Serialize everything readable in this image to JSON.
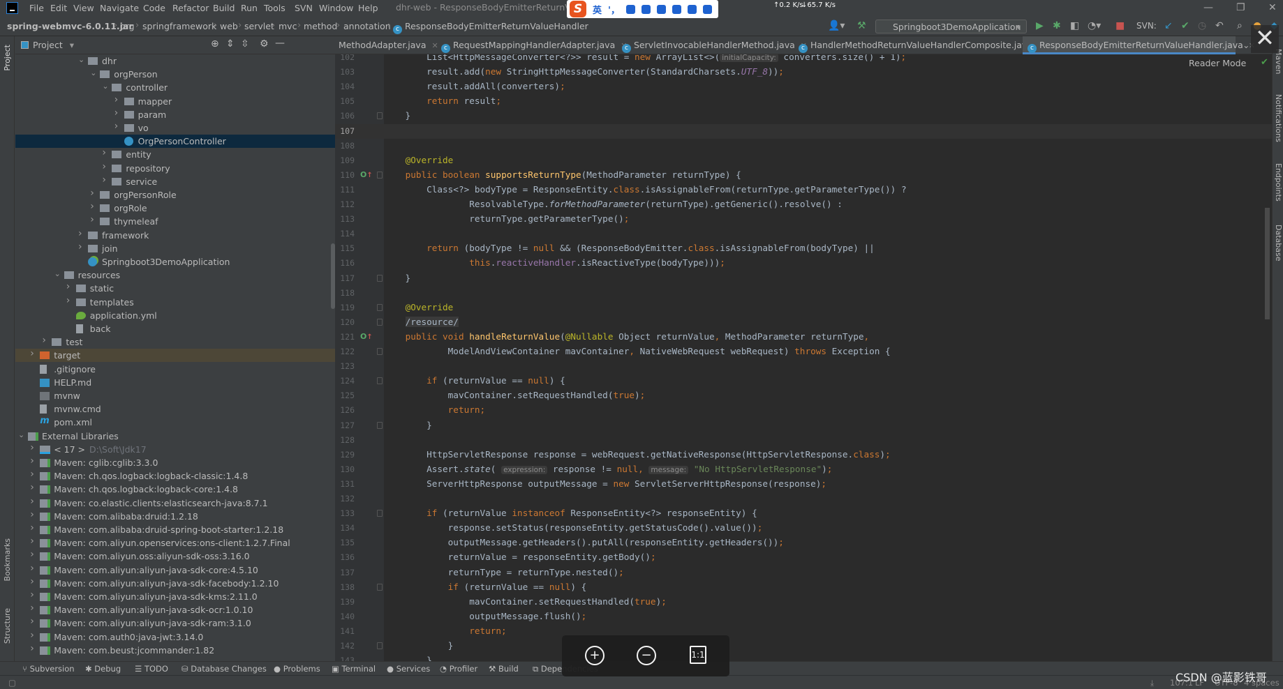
{
  "window": {
    "title": "dhr-web - ResponseBodyEmitterReturnValueHandler",
    "menu": [
      "File",
      "Edit",
      "View",
      "Navigate",
      "Code",
      "Refactor",
      "Build",
      "Run",
      "Tools",
      "SVN",
      "Window",
      "Help"
    ],
    "ime": {
      "lang": "英",
      "punct": "'，"
    },
    "net_up": "↑0.2 K/s",
    "net_down": "↓65.7 K/s"
  },
  "breadcrumb": [
    "spring-webmvc-6.0.11.jar",
    "org",
    "springframework",
    "web",
    "servlet",
    "mvc",
    "method",
    "annotation",
    "ResponseBodyEmitterReturnValueHandler"
  ],
  "toolbar": {
    "run_config": "Springboot3DemoApplication",
    "svn_label": "SVN:"
  },
  "project_panel": {
    "title": "Project",
    "items": [
      {
        "label": "dhr",
        "level": 5,
        "expand": "open",
        "icon": "folder"
      },
      {
        "label": "orgPerson",
        "level": 6,
        "expand": "open",
        "icon": "folder"
      },
      {
        "label": "controller",
        "level": 7,
        "expand": "open",
        "icon": "folder"
      },
      {
        "label": "mapper",
        "level": 8,
        "expand": "closed",
        "icon": "folder"
      },
      {
        "label": "param",
        "level": 8,
        "expand": "closed",
        "icon": "folder"
      },
      {
        "label": "vo",
        "level": 8,
        "expand": "closed",
        "icon": "folder"
      },
      {
        "label": "OrgPersonController",
        "level": 8,
        "icon": "cls",
        "selected": true
      },
      {
        "label": "entity",
        "level": 7,
        "expand": "closed",
        "icon": "folder"
      },
      {
        "label": "repository",
        "level": 7,
        "expand": "closed",
        "icon": "folder"
      },
      {
        "label": "service",
        "level": 7,
        "expand": "closed",
        "icon": "folder"
      },
      {
        "label": "orgPersonRole",
        "level": 6,
        "expand": "closed",
        "icon": "folder"
      },
      {
        "label": "orgRole",
        "level": 6,
        "expand": "closed",
        "icon": "folder"
      },
      {
        "label": "thymeleaf",
        "level": 6,
        "expand": "closed",
        "icon": "folder"
      },
      {
        "label": "framework",
        "level": 5,
        "expand": "closed",
        "icon": "folder"
      },
      {
        "label": "join",
        "level": 5,
        "expand": "closed",
        "icon": "folder"
      },
      {
        "label": "Springboot3DemoApplication",
        "level": 5,
        "icon": "spring"
      },
      {
        "label": "resources",
        "level": 3,
        "expand": "open",
        "icon": "folder"
      },
      {
        "label": "static",
        "level": 4,
        "expand": "closed",
        "icon": "folder"
      },
      {
        "label": "templates",
        "level": 4,
        "expand": "closed",
        "icon": "folder"
      },
      {
        "label": "application.yml",
        "level": 4,
        "icon": "yml"
      },
      {
        "label": "back",
        "level": 4,
        "icon": "file"
      },
      {
        "label": "test",
        "level": 2,
        "expand": "closed",
        "icon": "folder"
      },
      {
        "label": "target",
        "level": 1,
        "expand": "closed",
        "icon": "folder-orange",
        "highlight": true
      },
      {
        "label": ".gitignore",
        "level": 1,
        "icon": "file"
      },
      {
        "label": "HELP.md",
        "level": 1,
        "icon": "md"
      },
      {
        "label": "mvnw",
        "level": 1,
        "icon": "exec"
      },
      {
        "label": "mvnw.cmd",
        "level": 1,
        "icon": "file"
      },
      {
        "label": "pom.xml",
        "level": 1,
        "icon": "maven"
      },
      {
        "label": "External Libraries",
        "level": 0,
        "expand": "open",
        "icon": "lib"
      },
      {
        "label": "< 17 >",
        "level": 1,
        "expand": "closed",
        "icon": "jdk",
        "suffix": "D:\\Soft\\Jdk17"
      },
      {
        "label": "Maven: cglib:cglib:3.3.0",
        "level": 1,
        "expand": "closed",
        "icon": "lib"
      },
      {
        "label": "Maven: ch.qos.logback:logback-classic:1.4.8",
        "level": 1,
        "expand": "closed",
        "icon": "lib"
      },
      {
        "label": "Maven: ch.qos.logback:logback-core:1.4.8",
        "level": 1,
        "expand": "closed",
        "icon": "lib"
      },
      {
        "label": "Maven: co.elastic.clients:elasticsearch-java:8.7.1",
        "level": 1,
        "expand": "closed",
        "icon": "lib"
      },
      {
        "label": "Maven: com.alibaba:druid:1.2.18",
        "level": 1,
        "expand": "closed",
        "icon": "lib"
      },
      {
        "label": "Maven: com.alibaba:druid-spring-boot-starter:1.2.18",
        "level": 1,
        "expand": "closed",
        "icon": "lib"
      },
      {
        "label": "Maven: com.aliyun.openservices:ons-client:1.2.7.Final",
        "level": 1,
        "expand": "closed",
        "icon": "lib"
      },
      {
        "label": "Maven: com.aliyun.oss:aliyun-sdk-oss:3.16.0",
        "level": 1,
        "expand": "closed",
        "icon": "lib"
      },
      {
        "label": "Maven: com.aliyun:aliyun-java-sdk-core:4.5.10",
        "level": 1,
        "expand": "closed",
        "icon": "lib"
      },
      {
        "label": "Maven: com.aliyun:aliyun-java-sdk-facebody:1.2.10",
        "level": 1,
        "expand": "closed",
        "icon": "lib"
      },
      {
        "label": "Maven: com.aliyun:aliyun-java-sdk-kms:2.11.0",
        "level": 1,
        "expand": "closed",
        "icon": "lib"
      },
      {
        "label": "Maven: com.aliyun:aliyun-java-sdk-ocr:1.0.10",
        "level": 1,
        "expand": "closed",
        "icon": "lib"
      },
      {
        "label": "Maven: com.aliyun:aliyun-java-sdk-ram:3.1.0",
        "level": 1,
        "expand": "closed",
        "icon": "lib"
      },
      {
        "label": "Maven: com.auth0:java-jwt:3.14.0",
        "level": 1,
        "expand": "closed",
        "icon": "lib"
      },
      {
        "label": "Maven: com.beust:jcommander:1.82",
        "level": 1,
        "expand": "closed",
        "icon": "lib"
      }
    ]
  },
  "left_stripe": {
    "project": "Project",
    "bookmarks": "Bookmarks",
    "structure": "Structure"
  },
  "right_stripe": {
    "maven": "Maven",
    "notifications": "Notifications",
    "endpoints": "Endpoints",
    "database": "Database"
  },
  "editor": {
    "tabs": [
      {
        "label": "MethodAdapter.java",
        "active": false
      },
      {
        "label": "RequestMappingHandlerAdapter.java",
        "active": false
      },
      {
        "label": "ServletInvocableHandlerMethod.java",
        "active": false
      },
      {
        "label": "HandlerMethodReturnValueHandlerComposite.java",
        "active": false
      },
      {
        "label": "ResponseBodyEmitterReturnValueHandler.java",
        "active": true
      }
    ],
    "reader_mode": "Reader Mode",
    "current_line": 107,
    "lines": [
      {
        "n": 102,
        "t": [
          [
            "p",
            "        List<HttpMessageConverter<?>> result = "
          ],
          [
            "k",
            "new"
          ],
          [
            "p",
            " ArrayList<>("
          ],
          [
            "h",
            "initialCapacity:"
          ],
          [
            "p",
            " converters.size() + 1)"
          ],
          [
            "k",
            ";"
          ]
        ]
      },
      {
        "n": 103,
        "t": [
          [
            "p",
            "        result.add("
          ],
          [
            "k",
            "new"
          ],
          [
            "p",
            " StringHttpMessageConverter(StandardCharsets."
          ],
          [
            "sf",
            "UTF_8"
          ],
          [
            "p",
            "))"
          ],
          [
            "k",
            ";"
          ]
        ]
      },
      {
        "n": 104,
        "t": [
          [
            "p",
            "        result.addAll(converters)"
          ],
          [
            "k",
            ";"
          ]
        ]
      },
      {
        "n": 105,
        "t": [
          [
            "p",
            "        "
          ],
          [
            "k",
            "return"
          ],
          [
            "p",
            " result"
          ],
          [
            "k",
            ";"
          ]
        ]
      },
      {
        "n": 106,
        "t": [
          [
            "p",
            "    }"
          ]
        ],
        "fold": true
      },
      {
        "n": 107,
        "t": []
      },
      {
        "n": 108,
        "t": []
      },
      {
        "n": 109,
        "t": [
          [
            "p",
            "    "
          ],
          [
            "a",
            "@Override"
          ]
        ]
      },
      {
        "n": 110,
        "t": [
          [
            "p",
            "    "
          ],
          [
            "k",
            "public boolean"
          ],
          [
            "p",
            " "
          ],
          [
            "f",
            "supportsReturnType"
          ],
          [
            "p",
            "(MethodParameter returnType) {"
          ]
        ],
        "marker": true,
        "fold": true
      },
      {
        "n": 111,
        "t": [
          [
            "p",
            "        Class<?> bodyType = ResponseEntity."
          ],
          [
            "k",
            "class"
          ],
          [
            "p",
            ".isAssignableFrom(returnType.getParameterType()) ?"
          ]
        ]
      },
      {
        "n": 112,
        "t": [
          [
            "p",
            "                ResolvableType."
          ],
          [
            "i",
            "forMethodParameter"
          ],
          [
            "p",
            "(returnType).getGeneric().resolve() :"
          ]
        ]
      },
      {
        "n": 113,
        "t": [
          [
            "p",
            "                returnType.getParameterType()"
          ],
          [
            "k",
            ";"
          ]
        ]
      },
      {
        "n": 114,
        "t": []
      },
      {
        "n": 115,
        "t": [
          [
            "p",
            "        "
          ],
          [
            "k",
            "return"
          ],
          [
            "p",
            " (bodyType != "
          ],
          [
            "k",
            "null"
          ],
          [
            "p",
            " && (ResponseBodyEmitter."
          ],
          [
            "k",
            "class"
          ],
          [
            "p",
            ".isAssignableFrom(bodyType) ||"
          ]
        ]
      },
      {
        "n": 116,
        "t": [
          [
            "p",
            "                "
          ],
          [
            "k",
            "this"
          ],
          [
            "p",
            "."
          ],
          [
            "m",
            "reactiveHandler"
          ],
          [
            "p",
            ".isReactiveType(bodyType)))"
          ],
          [
            "k",
            ";"
          ]
        ]
      },
      {
        "n": 117,
        "t": [
          [
            "p",
            "    }"
          ]
        ],
        "fold": true
      },
      {
        "n": 118,
        "t": []
      },
      {
        "n": 119,
        "t": [
          [
            "p",
            "    "
          ],
          [
            "a",
            "@Override"
          ]
        ],
        "fold": true
      },
      {
        "n": 120,
        "t": [
          [
            "p",
            "    "
          ],
          [
            "g",
            "/resource/"
          ]
        ],
        "fold": true
      },
      {
        "n": 121,
        "t": [
          [
            "p",
            "    "
          ],
          [
            "k",
            "public void"
          ],
          [
            "p",
            " "
          ],
          [
            "f",
            "handleReturnValue"
          ],
          [
            "p",
            "("
          ],
          [
            "a",
            "@Nullable"
          ],
          [
            "p",
            " Object returnValue"
          ],
          [
            "k",
            ","
          ],
          [
            "p",
            " MethodParameter returnType"
          ],
          [
            "k",
            ","
          ]
        ],
        "marker": true
      },
      {
        "n": 122,
        "t": [
          [
            "p",
            "            ModelAndViewContainer mavContainer"
          ],
          [
            "k",
            ","
          ],
          [
            "p",
            " NativeWebRequest webRequest) "
          ],
          [
            "k",
            "throws"
          ],
          [
            "p",
            " Exception {"
          ]
        ],
        "fold": true
      },
      {
        "n": 123,
        "t": []
      },
      {
        "n": 124,
        "t": [
          [
            "p",
            "        "
          ],
          [
            "k",
            "if"
          ],
          [
            "p",
            " (returnValue == "
          ],
          [
            "k",
            "null"
          ],
          [
            "p",
            ") {"
          ]
        ],
        "fold": true
      },
      {
        "n": 125,
        "t": [
          [
            "p",
            "            mavContainer.setRequestHandled("
          ],
          [
            "k",
            "true"
          ],
          [
            "p",
            ")"
          ],
          [
            "k",
            ";"
          ]
        ]
      },
      {
        "n": 126,
        "t": [
          [
            "p",
            "            "
          ],
          [
            "k",
            "return;"
          ]
        ]
      },
      {
        "n": 127,
        "t": [
          [
            "p",
            "        }"
          ]
        ],
        "fold": true
      },
      {
        "n": 128,
        "t": []
      },
      {
        "n": 129,
        "t": [
          [
            "p",
            "        HttpServletResponse response = webRequest.getNativeResponse(HttpServletResponse."
          ],
          [
            "k",
            "class"
          ],
          [
            "p",
            ")"
          ],
          [
            "k",
            ";"
          ]
        ]
      },
      {
        "n": 130,
        "t": [
          [
            "p",
            "        Assert."
          ],
          [
            "i",
            "state"
          ],
          [
            "p",
            "( "
          ],
          [
            "h",
            "expression:"
          ],
          [
            "p",
            " response != "
          ],
          [
            "k",
            "null,"
          ],
          [
            "p",
            " "
          ],
          [
            "h",
            "message:"
          ],
          [
            "p",
            " "
          ],
          [
            "s",
            "\"No HttpServletResponse\""
          ],
          [
            "p",
            ")"
          ],
          [
            "k",
            ";"
          ]
        ]
      },
      {
        "n": 131,
        "t": [
          [
            "p",
            "        ServerHttpResponse outputMessage = "
          ],
          [
            "k",
            "new"
          ],
          [
            "p",
            " ServletServerHttpResponse(response)"
          ],
          [
            "k",
            ";"
          ]
        ]
      },
      {
        "n": 132,
        "t": []
      },
      {
        "n": 133,
        "t": [
          [
            "p",
            "        "
          ],
          [
            "k",
            "if"
          ],
          [
            "p",
            " (returnValue "
          ],
          [
            "k",
            "instanceof"
          ],
          [
            "p",
            " ResponseEntity<?> responseEntity) {"
          ]
        ],
        "fold": true
      },
      {
        "n": 134,
        "t": [
          [
            "p",
            "            response.setStatus(responseEntity.getStatusCode().value())"
          ],
          [
            "k",
            ";"
          ]
        ]
      },
      {
        "n": 135,
        "t": [
          [
            "p",
            "            outputMessage.getHeaders().putAll(responseEntity.getHeaders())"
          ],
          [
            "k",
            ";"
          ]
        ]
      },
      {
        "n": 136,
        "t": [
          [
            "p",
            "            returnValue = responseEntity.getBody()"
          ],
          [
            "k",
            ";"
          ]
        ]
      },
      {
        "n": 137,
        "t": [
          [
            "p",
            "            returnType = returnType.nested()"
          ],
          [
            "k",
            ";"
          ]
        ]
      },
      {
        "n": 138,
        "t": [
          [
            "p",
            "            "
          ],
          [
            "k",
            "if"
          ],
          [
            "p",
            " (returnValue == "
          ],
          [
            "k",
            "null"
          ],
          [
            "p",
            ") {"
          ]
        ],
        "fold": true
      },
      {
        "n": 139,
        "t": [
          [
            "p",
            "                mavContainer.setRequestHandled("
          ],
          [
            "k",
            "true"
          ],
          [
            "p",
            ")"
          ],
          [
            "k",
            ";"
          ]
        ]
      },
      {
        "n": 140,
        "t": [
          [
            "p",
            "                outputMessage.flush()"
          ],
          [
            "k",
            ";"
          ]
        ]
      },
      {
        "n": 141,
        "t": [
          [
            "p",
            "                "
          ],
          [
            "k",
            "return;"
          ]
        ]
      },
      {
        "n": 142,
        "t": [
          [
            "p",
            "            }"
          ]
        ],
        "fold": true
      },
      {
        "n": 143,
        "t": [
          [
            "p",
            "        }"
          ]
        ]
      }
    ]
  },
  "zoom_controls": {
    "zoom_in": "+",
    "zoom_out": "−",
    "actual_size": "1:1"
  },
  "bottom_tools": [
    "Subversion",
    "Debug",
    "TODO",
    "Database Changes",
    "Problems",
    "Terminal",
    "Services",
    "Profiler",
    "Build",
    "Dependencies"
  ],
  "status": {
    "position": "107:1",
    "line_sep": "LF",
    "encoding": "UTF-8",
    "indent": "4 spaces"
  },
  "watermark": "CSDN @蓝影铁哥",
  "colors": {
    "keyword": "#cc7832",
    "method_decl": "#ffc66d",
    "annotation": "#bbb529",
    "string": "#6a8759",
    "field": "#9876aa",
    "accent": "#4a88c7",
    "selection": "#0d293e"
  }
}
